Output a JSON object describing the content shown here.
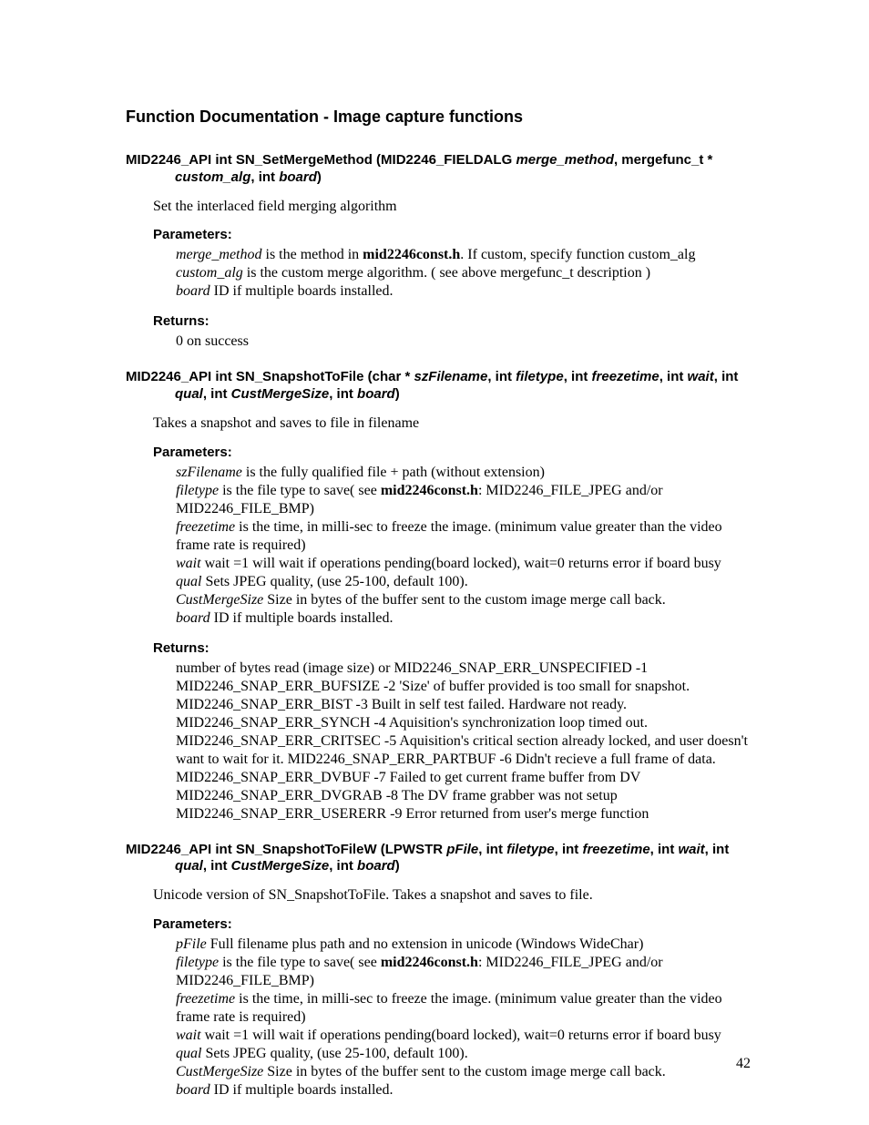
{
  "page_number": "42",
  "title": "Function Documentation - Image capture functions",
  "labels": {
    "parameters": "Parameters:",
    "returns": "Returns:"
  },
  "f1": {
    "sig_prefix": "MID2246_API int SN_SetMergeMethod (MID2246_FIELDALG ",
    "p_merge_method": "merge_method",
    "sig_mid1": ", mergefunc_t * ",
    "p_custom_alg": "custom_alg",
    "sig_mid2": ", int ",
    "p_board": "board",
    "sig_end": ")",
    "desc": "Set the interlaced field merging algorithm",
    "params": {
      "l1a": "merge_method",
      "l1b": " is the method in ",
      "l1c": "mid2246const.h",
      "l1d": ". If custom, specify function custom_alg",
      "l2a": "custom_alg",
      "l2b": " is the custom merge algorithm. ( see above mergefunc_t description )",
      "l3a": "board",
      "l3b": " ID if multiple boards installed."
    },
    "returns": "0 on success"
  },
  "f2": {
    "sig_prefix": "MID2246_API int SN_SnapshotToFile (char * ",
    "p_szFilename": "szFilename",
    "s1": ", int ",
    "p_filetype": "filetype",
    "s2": ", int ",
    "p_freezetime": "freezetime",
    "s3": ", int ",
    "p_wait": "wait",
    "s4": ", int ",
    "p_qual": "qual",
    "s5": ", int ",
    "p_CustMergeSize": "CustMergeSize",
    "s6": ", int ",
    "p_board": "board",
    "sig_end": ")",
    "desc": "Takes a snapshot and saves to file in filename",
    "params": {
      "l1a": "szFilename",
      "l1b": " is the fully qualified file + path (without extension)",
      "l2a": "filetype",
      "l2b": " is the file type to save( see ",
      "l2c": "mid2246const.h",
      "l2d": ": MID2246_FILE_JPEG and/or MID2246_FILE_BMP)",
      "l3a": "freezetime",
      "l3b": " is the time, in milli-sec to freeze the image. (minimum value greater than the video frame rate is required)",
      "l4a": "wait",
      "l4b": " wait =1 will wait if operations pending(board locked), wait=0 returns error if board busy",
      "l5a": "qual",
      "l5b": " Sets JPEG quality, (use 25-100, default 100).",
      "l6a": "CustMergeSize",
      "l6b": " Size in bytes of the buffer sent to the custom image merge call back.",
      "l7a": "board",
      "l7b": " ID if multiple boards installed."
    },
    "returns": {
      "r1": "number of bytes read (image size) or MID2246_SNAP_ERR_UNSPECIFIED -1",
      "r2": "MID2246_SNAP_ERR_BUFSIZE -2 'Size' of buffer provided is too small for snapshot.",
      "r3": "MID2246_SNAP_ERR_BIST -3 Built in self test failed. Hardware not ready.",
      "r4": "MID2246_SNAP_ERR_SYNCH -4 Aquisition's synchronization loop timed out.",
      "r5": "MID2246_SNAP_ERR_CRITSEC -5 Aquisition's critical section already locked, and user doesn't want to wait for it. MID2246_SNAP_ERR_PARTBUF -6 Didn't recieve a full frame of data.",
      "r6": "MID2246_SNAP_ERR_DVBUF -7 Failed to get current frame buffer from DV",
      "r7": "MID2246_SNAP_ERR_DVGRAB -8 The DV frame grabber was not setup",
      "r8": "MID2246_SNAP_ERR_USERERR -9 Error returned from user's merge function"
    }
  },
  "f3": {
    "sig_prefix": "MID2246_API int SN_SnapshotToFileW (LPWSTR ",
    "p_pFile": "pFile",
    "s1": ", int ",
    "p_filetype": "filetype",
    "s2": ", int ",
    "p_freezetime": "freezetime",
    "s3": ", int ",
    "p_wait": "wait",
    "s4": ", int ",
    "p_qual": "qual",
    "s5": ", int ",
    "p_CustMergeSize": "CustMergeSize",
    "s6": ", int ",
    "p_board": "board",
    "sig_end": ")",
    "desc": "Unicode version of SN_SnapshotToFile. Takes a snapshot and saves to file.",
    "params": {
      "l1a": "pFile",
      "l1b": " Full filename plus path and no extension in unicode (Windows WideChar)",
      "l2a": "filetype",
      "l2b": " is the file type to save( see ",
      "l2c": "mid2246const.h",
      "l2d": ": MID2246_FILE_JPEG and/or MID2246_FILE_BMP)",
      "l3a": "freezetime",
      "l3b": " is the time, in milli-sec to freeze the image. (minimum value greater than the video frame rate is required)",
      "l4a": "wait",
      "l4b": " wait =1 will wait if operations pending(board locked), wait=0 returns error if board busy",
      "l5a": "qual",
      "l5b": " Sets JPEG quality, (use 25-100, default 100).",
      "l6a": "CustMergeSize",
      "l6b": " Size in bytes of the buffer sent to the custom image merge call back.",
      "l7a": "board",
      "l7b": " ID if multiple boards installed."
    }
  }
}
